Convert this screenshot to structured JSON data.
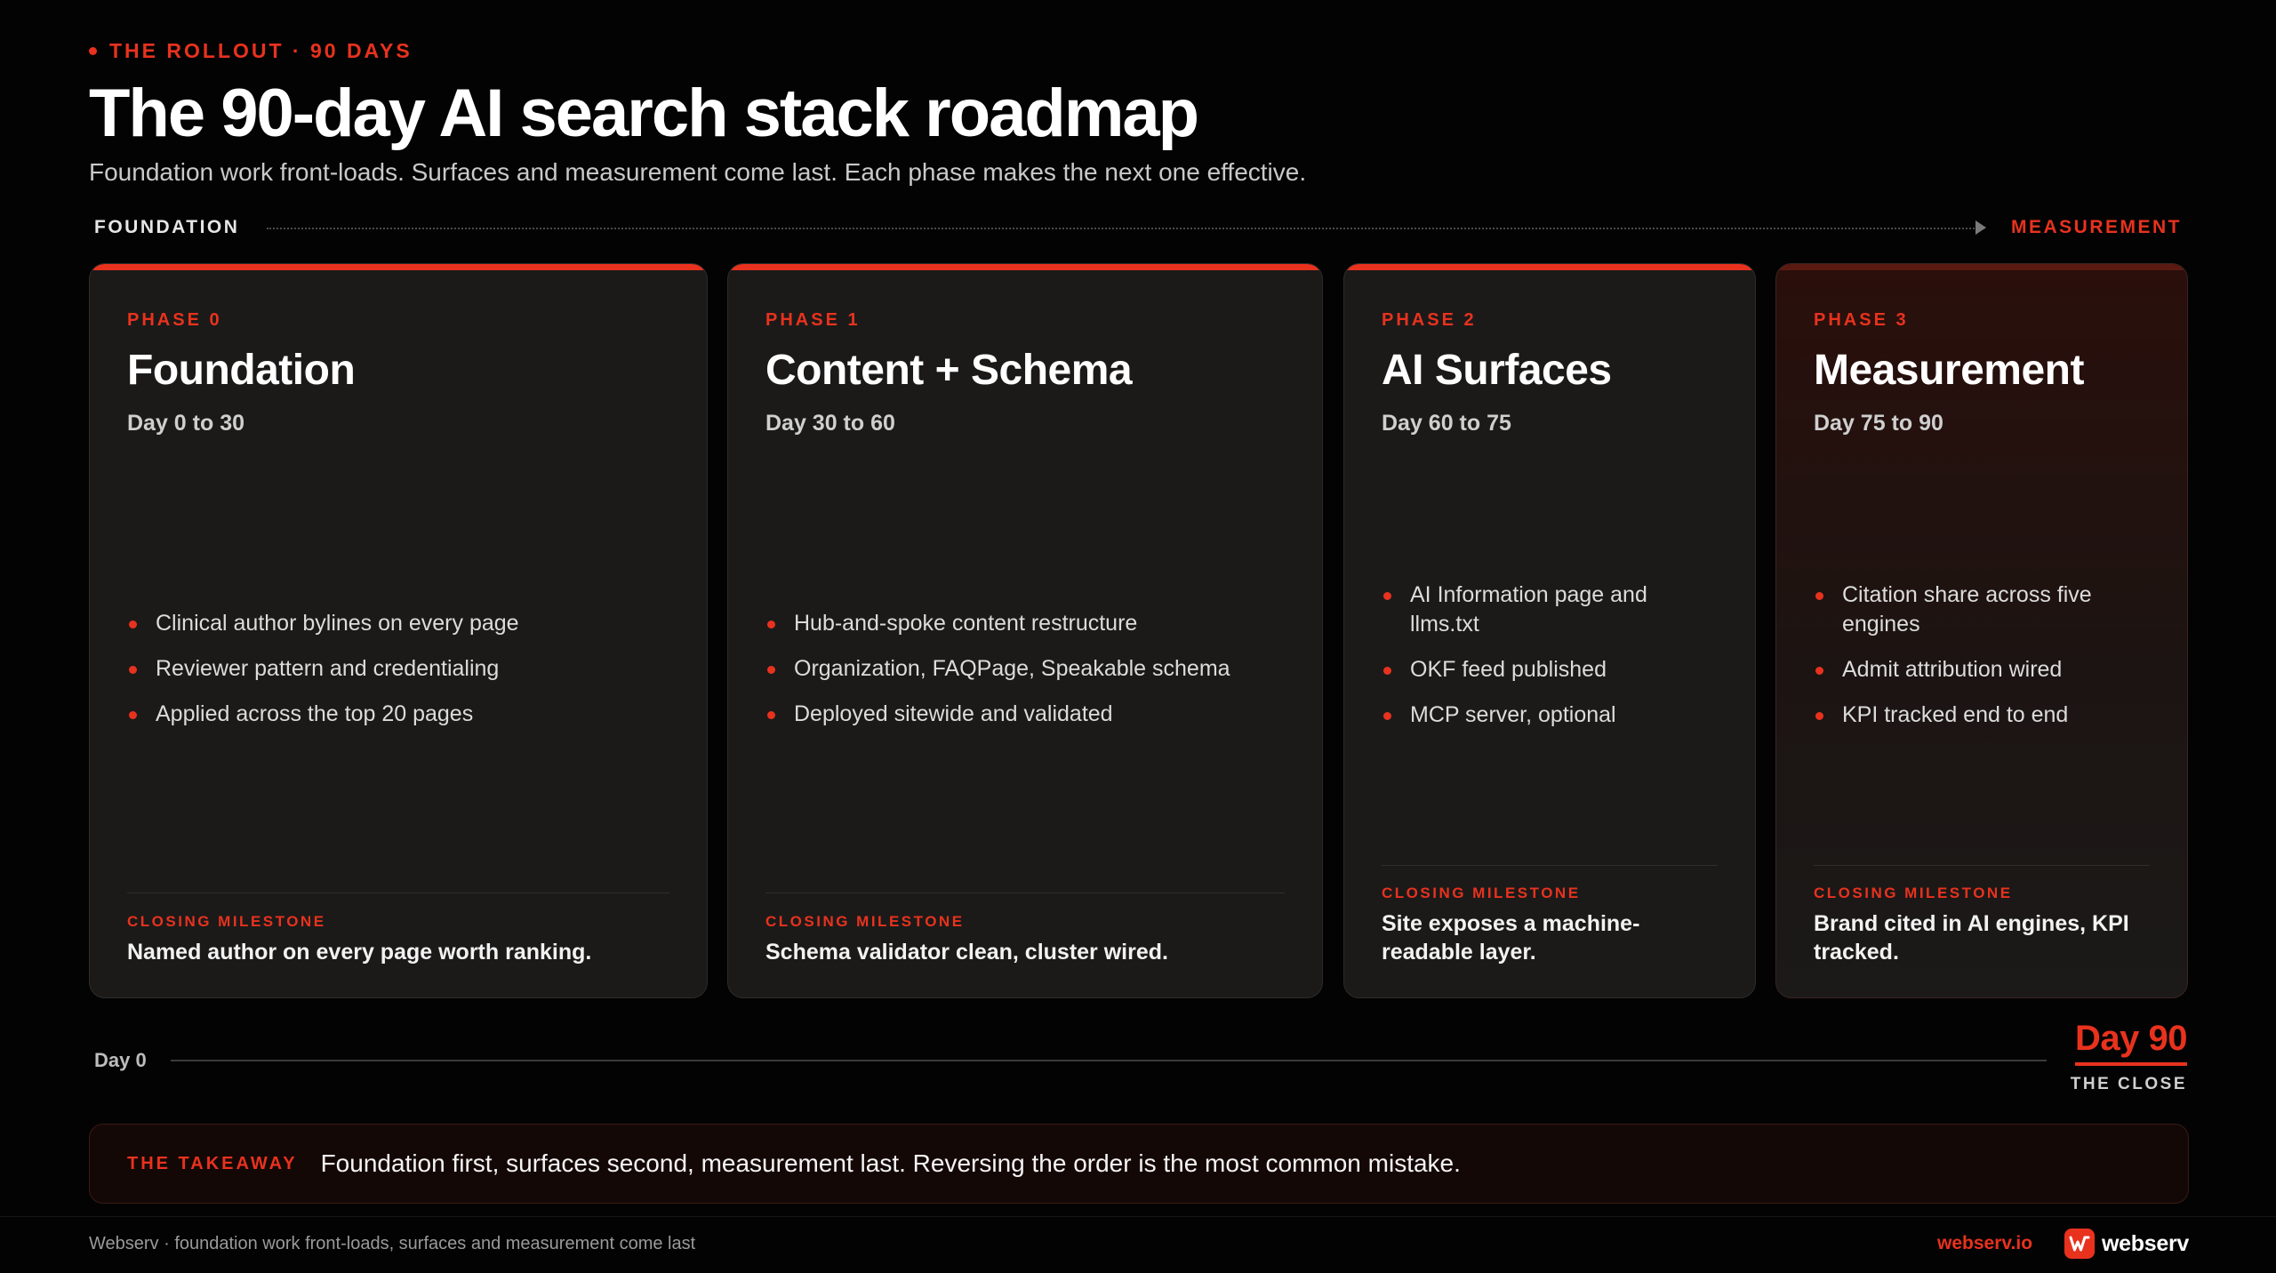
{
  "header": {
    "eyebrow": "THE ROLLOUT · 90 DAYS",
    "title": "The 90-day AI search stack roadmap",
    "subtitle": "Foundation work front-loads. Surfaces and measurement come last. Each phase makes the next one effective."
  },
  "flow": {
    "start_label": "FOUNDATION",
    "end_label": "MEASUREMENT"
  },
  "phases": [
    {
      "label": "PHASE 0",
      "name": "Foundation",
      "days": "Day 0 to 30",
      "bullets": [
        "Clinical author bylines on every page",
        "Reviewer pattern and credentialing",
        "Applied across the top 20 pages"
      ],
      "milestone_label": "CLOSING MILESTONE",
      "milestone_text": "Named author on every page worth ranking."
    },
    {
      "label": "PHASE 1",
      "name": "Content + Schema",
      "days": "Day 30 to 60",
      "bullets": [
        "Hub-and-spoke content restructure",
        "Organization, FAQPage, Speakable schema",
        "Deployed sitewide and validated"
      ],
      "milestone_label": "CLOSING MILESTONE",
      "milestone_text": "Schema validator clean, cluster wired."
    },
    {
      "label": "PHASE 2",
      "name": "AI Surfaces",
      "days": "Day 60 to 75",
      "bullets": [
        "AI Information page and llms.txt",
        "OKF feed published",
        "MCP server, optional"
      ],
      "milestone_label": "CLOSING MILESTONE",
      "milestone_text": "Site exposes a machine-readable layer."
    },
    {
      "label": "PHASE 3",
      "name": "Measurement",
      "days": "Day 75 to 90",
      "bullets": [
        "Citation share across five engines",
        "Admit attribution wired",
        "KPI tracked end to end"
      ],
      "milestone_label": "CLOSING MILESTONE",
      "milestone_text": "Brand cited in AI engines, KPI tracked."
    }
  ],
  "timeline": {
    "start": "Day 0",
    "end": "Day 90",
    "end_caption": "THE CLOSE"
  },
  "takeaway": {
    "label": "THE TAKEAWAY",
    "text": "Foundation first, surfaces second, measurement last. Reversing the order is the most common mistake."
  },
  "footer": {
    "left": "Webserv · foundation work front-loads, surfaces and measurement come last",
    "link": "webserv.io",
    "brand": "webserv",
    "brand_icon": "webserv-logo-icon"
  },
  "colors": {
    "accent": "#e8321e",
    "background": "#030303",
    "card": "#1b1a19"
  }
}
